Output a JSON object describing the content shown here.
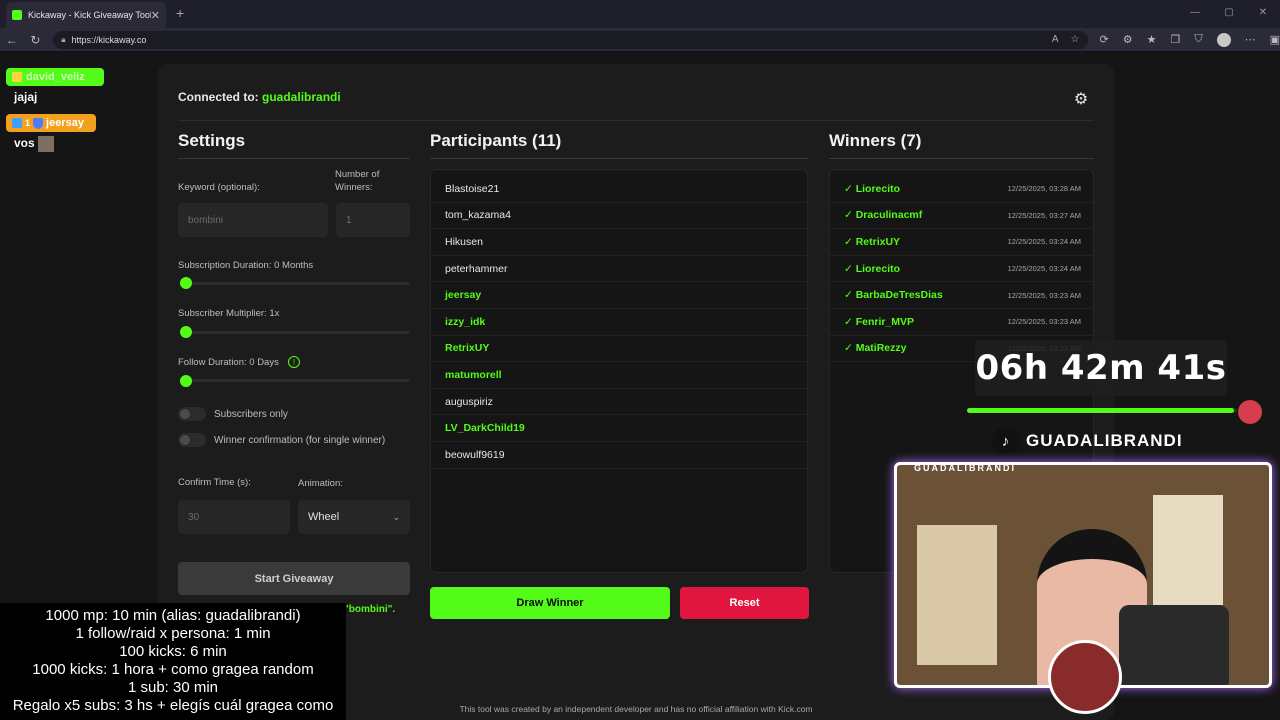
{
  "browser": {
    "tab_title": "Kickaway - Kick Giveaway Tool",
    "url": "https://kickaway.co"
  },
  "header": {
    "connected_label": "Connected to:",
    "connected_user": "guadalibrandi"
  },
  "settings": {
    "title": "Settings",
    "keyword_label": "Keyword (optional):",
    "keyword_placeholder": "bombini",
    "winners_label_line1": "Number of",
    "winners_label_line2": "Winners:",
    "winners_placeholder": "1",
    "sub_duration_label": "Subscription Duration: 0 Months",
    "sub_multiplier_label": "Subscriber Multiplier: 1x",
    "follow_duration_label": "Follow Duration: 0 Days",
    "subscribers_only_label": "Subscribers only",
    "winner_confirmation_label": "Winner confirmation (for single winner)",
    "confirm_time_label": "Confirm Time (s):",
    "confirm_time_placeholder": "30",
    "animation_label": "Animation:",
    "animation_value": "Wheel",
    "start_button": "Start Giveaway",
    "keyword_note": "\"bombini\"."
  },
  "participants": {
    "title": "Participants (11)",
    "items": [
      {
        "name": "Blastoise21",
        "highlight": false
      },
      {
        "name": "tom_kazama4",
        "highlight": false
      },
      {
        "name": "Hikusen",
        "highlight": false
      },
      {
        "name": "peterhammer",
        "highlight": false
      },
      {
        "name": "jeersay",
        "highlight": true
      },
      {
        "name": "izzy_idk",
        "highlight": true
      },
      {
        "name": "RetrixUY",
        "highlight": true
      },
      {
        "name": "matumorell",
        "highlight": true
      },
      {
        "name": "auguspiriz",
        "highlight": false
      },
      {
        "name": "LV_DarkChild19",
        "highlight": true
      },
      {
        "name": "beowulf9619",
        "highlight": false
      }
    ]
  },
  "winners": {
    "title": "Winners (7)",
    "items": [
      {
        "name": "✓ Liorecito",
        "time": "12/25/2025, 03:28 AM"
      },
      {
        "name": "✓ Draculinacmf",
        "time": "12/25/2025, 03:27 AM"
      },
      {
        "name": "✓ RetrixUY",
        "time": "12/25/2025, 03:24 AM"
      },
      {
        "name": "✓ Liorecito",
        "time": "12/25/2025, 03:24 AM"
      },
      {
        "name": "✓ BarbaDeTresDias",
        "time": "12/25/2025, 03:23 AM"
      },
      {
        "name": "✓ Fenrir_MVP",
        "time": "12/25/2025, 03:23 AM"
      },
      {
        "name": "✓ MatiRezzy",
        "time": "12/25/2025, 03:23 AM"
      }
    ]
  },
  "actions": {
    "draw_winner": "Draw Winner",
    "reset": "Reset"
  },
  "footer": "This tool was created by an independent developer and has no official affiliation with Kick.com",
  "overlay": {
    "chat": [
      {
        "user": "david_veliz",
        "message": "jajaj"
      },
      {
        "user": "jeersay",
        "badge_count": "1",
        "message": "vos"
      }
    ],
    "rules": [
      "1000 mp: 10 min (alias: guadalibrandi)",
      "1 follow/raid x persona: 1 min",
      "100 kicks: 6 min",
      "1000 kicks: 1 hora + como gragea random",
      "1 sub: 30 min",
      "Regalo x5 subs: 3 hs + elegís cuál gragea como"
    ],
    "timer": "06h 42m 41s",
    "timer_progress": 0.99,
    "tiktok_handle": "GUADALIBRANDI",
    "cam_label": "GUADALIBRANDI"
  },
  "colors": {
    "accent": "#53fc18",
    "danger": "#e0163f",
    "background": "#151515",
    "panel": "#1c1c1c"
  }
}
